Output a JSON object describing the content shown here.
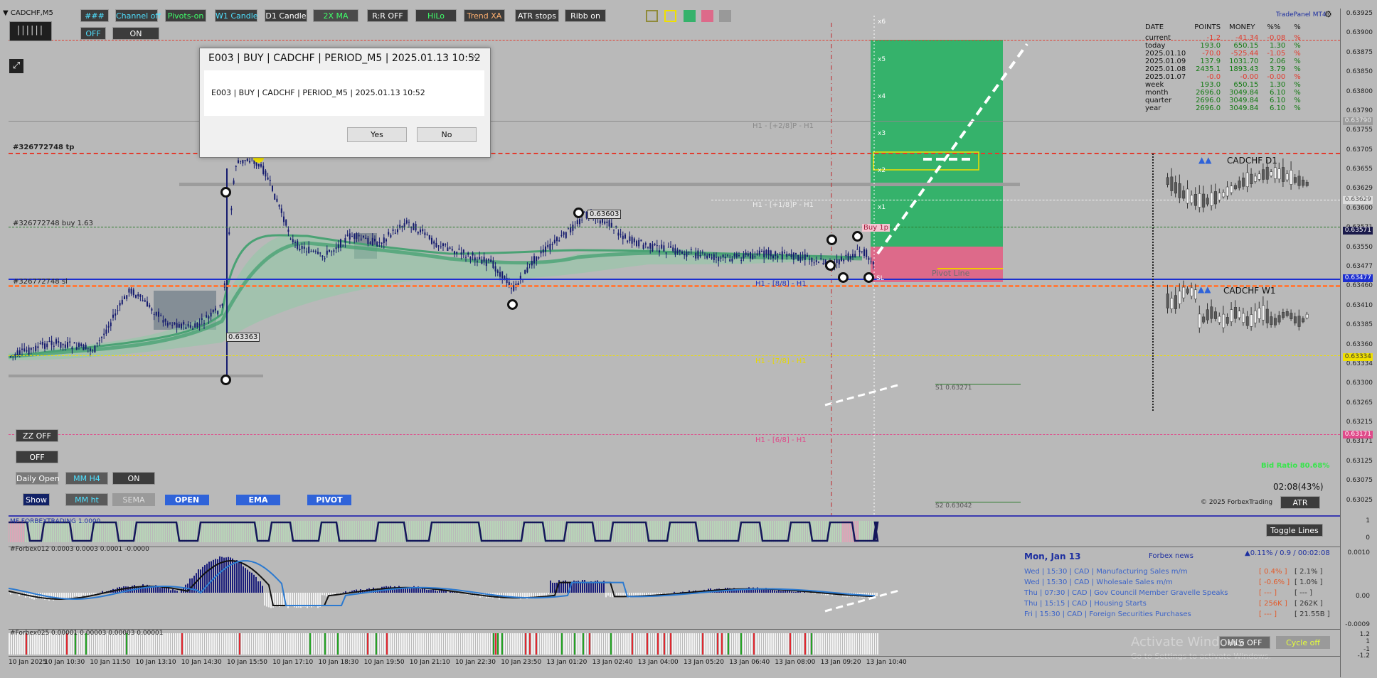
{
  "symbol": "CADCHF,M5",
  "toolbar": {
    "row1": [
      "###",
      "Channel off",
      "Pivots-on",
      "W1 Candle",
      "D1 Candle",
      "2X MA",
      "R:R OFF",
      "HiLo",
      "Trend XA",
      "ATR stops",
      "Ribb on"
    ],
    "row2": [
      "OFF",
      "ON"
    ]
  },
  "left_buttons": {
    "zz": "ZZ OFF",
    "off": "OFF",
    "daily_open": "Daily Open",
    "mm_h4": "MM H4",
    "on": "ON",
    "show": "Show",
    "mm_ht": "MM ht",
    "sema": "SEMA",
    "open": "OPEN",
    "ema": "EMA",
    "pivot": "PIVOT"
  },
  "dialog": {
    "title": "E003 | BUY | CADCHF | PERIOD_M5 | 2025.01.13 10:52",
    "message": "E003 | BUY | CADCHF | PERIOD_M5 | 2025.01.13 10:52",
    "yes": "Yes",
    "no": "No",
    "close": "×"
  },
  "chart_labels": {
    "tp": "#326772748 tp",
    "buy": "#326772748 buy 1.63",
    "sl": "#326772748 sl",
    "h1_p28": "H1 - [+2/8]P - H1",
    "h1_p18": "H1 - [+1/8]P - H1",
    "h1_88": "H1 - [8/8] - H1",
    "h1_78": "H1 - [7/8] - H1",
    "h1_68": "H1 - [6/8] - H1",
    "pivot_line": "Pivot Line",
    "s1": "S1 0.63271",
    "s2": "S2 0.63042",
    "price_63603": "0.63603",
    "price_63363": "0.63363",
    "buy_tag": "Buy 1p",
    "sl_tag": "SL",
    "x_levels": [
      "x6",
      "x5",
      "x4",
      "x3",
      "x2",
      "x1"
    ]
  },
  "panel": {
    "brand": "TradePanel MT4",
    "headers": [
      "DATE",
      "POINTS",
      "MONEY",
      "%%",
      "%"
    ],
    "rows": [
      {
        "label": "current",
        "points": "-1.2",
        "money": "-41.34",
        "pct": "-0.08",
        "unit": "%"
      },
      {
        "label": "today",
        "points": "193.0",
        "money": "650.15",
        "pct": "1.30",
        "unit": "%"
      },
      {
        "label": "2025.01.10",
        "points": "-70.0",
        "money": "-525.44",
        "pct": "-1.05",
        "unit": "%"
      },
      {
        "label": "2025.01.09",
        "points": "137.9",
        "money": "1031.70",
        "pct": "2.06",
        "unit": "%"
      },
      {
        "label": "2025.01.08",
        "points": "2435.1",
        "money": "1893.43",
        "pct": "3.79",
        "unit": "%"
      },
      {
        "label": "2025.01.07",
        "points": "-0.0",
        "money": "-0.00",
        "pct": "-0.00",
        "unit": "%"
      },
      {
        "label": "week",
        "points": "193.0",
        "money": "650.15",
        "pct": "1.30",
        "unit": "%"
      },
      {
        "label": "month",
        "points": "2696.0",
        "money": "3049.84",
        "pct": "6.10",
        "unit": "%"
      },
      {
        "label": "quarter",
        "points": "2696.0",
        "money": "3049.84",
        "pct": "6.10",
        "unit": "%"
      },
      {
        "label": "year",
        "points": "2696.0",
        "money": "3049.84",
        "pct": "6.10",
        "unit": "%"
      }
    ],
    "d1": "CADCHF  D1",
    "w1": "CADCHF  W1",
    "bid_ratio": "Bid Ratio 80.68%",
    "timer": "02:08(43%)",
    "copyright": "© 2025 ForbexTrading",
    "atr": "ATR",
    "toggle_lines": "Toggle Lines"
  },
  "price_scale": [
    "0.63925",
    "0.63900",
    "0.63875",
    "0.63850",
    "0.63800",
    "0.63790",
    "0.63755",
    "0.63705",
    "0.63655",
    "0.63629",
    "0.63600",
    "0.63571",
    "0.63550",
    "0.63477",
    "0.63460",
    "0.63410",
    "0.63385",
    "0.63360",
    "0.63334",
    "0.63300",
    "0.63265",
    "0.63215",
    "0.63171",
    "0.63125",
    "0.63075",
    "0.63025"
  ],
  "price_tags": {
    "a": "0.63477",
    "b": "0.63571",
    "c": "0.63171",
    "d": "0.63334",
    "e": "0.63629",
    "f": "0.63790"
  },
  "indicators": {
    "mf": "MF FORBEXTRADING 1.0000",
    "forbex012": "#Forbex012 0.0003 0.0003 0.0001 -0.0000",
    "forbex025": "#Forbex025 0.00001 0.00003 0.00003 0.00001",
    "scale_mf": [
      "1",
      "0"
    ],
    "scale_osc": [
      "0.0010",
      "0.00",
      "-0.0009"
    ],
    "scale_vol": [
      "1.2",
      "1",
      "-1",
      "-1.2"
    ]
  },
  "news": {
    "date": "Mon, Jan 13",
    "title": "Forbex news",
    "stats": "▲0.11% / 0.9 / 00:02:08",
    "items": [
      {
        "text": "Wed  |  15:30  |  CAD  |  Manufacturing Sales m/m",
        "a": "[ 0.4% ]",
        "b": "[ 2.1% ]"
      },
      {
        "text": "Wed  |  15:30  |  CAD  |  Wholesale Sales m/m",
        "a": "[ -0.6% ]",
        "b": "[ 1.0% ]"
      },
      {
        "text": "Thu  |  07:30  |  CAD  |  Gov Council Member Gravelle Speaks",
        "a": "[ --- ]",
        "b": "[ --- ]"
      },
      {
        "text": "Thu  |  15:15  |  CAD  |  Housing Starts",
        "a": "[ 256K ]",
        "b": "[ 262K ]"
      },
      {
        "text": "Fri  |  15:30  |  CAD  |  Foreign Securities Purchases",
        "a": "[ --- ]",
        "b": "[ 21.55B ]"
      }
    ]
  },
  "bottom_buttons": {
    "hilo": "HiLo OFF",
    "cycle": "Cycle off"
  },
  "watermark": "Activate Windows",
  "watermark_sub": "Go to Settings to activate Windows.",
  "time_axis": [
    "10 Jan 2025",
    "10 Jan 10:30",
    "10 Jan 11:50",
    "10 Jan 13:10",
    "10 Jan 14:30",
    "10 Jan 15:50",
    "10 Jan 17:10",
    "10 Jan 18:30",
    "10 Jan 19:50",
    "10 Jan 21:10",
    "10 Jan 22:30",
    "10 Jan 23:50",
    "13 Jan 01:20",
    "13 Jan 02:40",
    "13 Jan 04:00",
    "13 Jan 05:20",
    "13 Jan 06:40",
    "13 Jan 08:00",
    "13 Jan 09:20",
    "13 Jan 10:40"
  ],
  "colors": {
    "bg": "#b9b9b9",
    "green_zone": "#35b26b",
    "pink_zone": "#dd6a8a",
    "blue_line": "#1d2fd0",
    "tp_line": "#e23c2e"
  }
}
